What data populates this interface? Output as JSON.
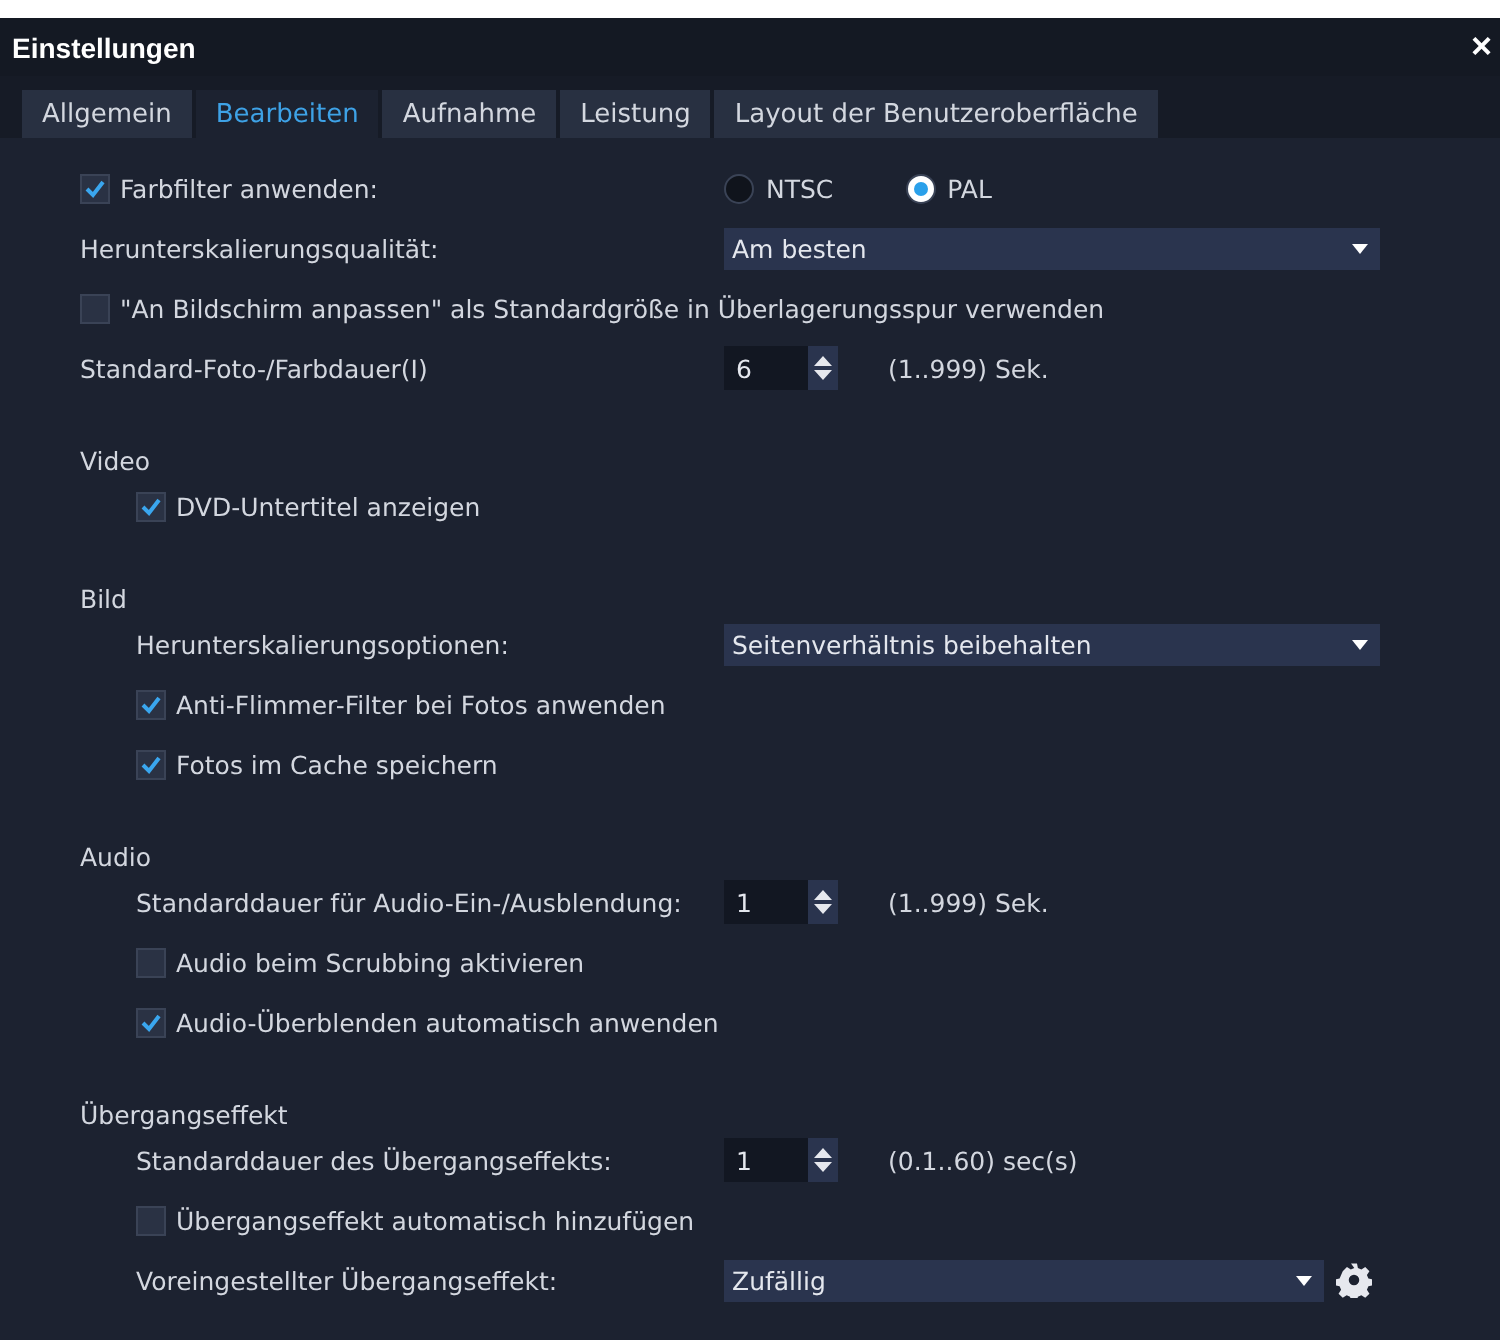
{
  "window": {
    "title": "Einstellungen",
    "close": "×"
  },
  "tabs": [
    {
      "label": "Allgemein",
      "selected": false
    },
    {
      "label": "Bearbeiten",
      "selected": true
    },
    {
      "label": "Aufnahme",
      "selected": false
    },
    {
      "label": "Leistung",
      "selected": false
    },
    {
      "label": "Layout der Benutzeroberfläche",
      "selected": false
    }
  ],
  "rows": [
    {
      "kind": "checkbox",
      "label": "Farbfilter anwenden:",
      "checked": true,
      "options": [
        {
          "label": "NTSC",
          "selected": false
        },
        {
          "label": "PAL",
          "selected": true
        }
      ]
    },
    {
      "kind": "dropdown",
      "label": "Herunterskalierungsqualität:",
      "value": "Am besten"
    },
    {
      "kind": "checkbox",
      "label": "\"An Bildschirm anpassen\" als Standardgröße in Überlagerungsspur verwenden",
      "checked": false
    },
    {
      "kind": "spinner",
      "label": "Standard-Foto-/Farbdauer(I)",
      "value": "6",
      "range": "(1..999) Sek."
    }
  ],
  "sections": [
    {
      "title": "Video",
      "children": [
        {
          "kind": "checkbox",
          "label": "DVD-Untertitel anzeigen",
          "checked": true
        }
      ]
    },
    {
      "title": "Bild",
      "children": [
        {
          "kind": "dropdown",
          "label": "Herunterskalierungsoptionen:",
          "value": "Seitenverhältnis beibehalten"
        },
        {
          "kind": "checkbox",
          "label": "Anti-Flimmer-Filter bei Fotos anwenden",
          "checked": true
        },
        {
          "kind": "checkbox",
          "label": "Fotos im Cache speichern",
          "checked": true
        }
      ]
    },
    {
      "title": "Audio",
      "children": [
        {
          "kind": "spinner",
          "label": "Standarddauer für Audio-Ein-/Ausblendung:",
          "value": "1",
          "range": "(1..999) Sek."
        },
        {
          "kind": "checkbox",
          "label": "Audio beim Scrubbing aktivieren",
          "checked": false
        },
        {
          "kind": "checkbox",
          "label": "Audio-Überblenden automatisch anwenden",
          "checked": true
        }
      ]
    },
    {
      "title": "Übergangseffekt",
      "children": [
        {
          "kind": "spinner",
          "label": "Standarddauer des Übergangseffekts:",
          "value": "1",
          "range": "(0.1..60) sec(s)"
        },
        {
          "kind": "checkbox",
          "label": "Übergangseffekt automatisch hinzufügen",
          "checked": false
        },
        {
          "kind": "dropdown",
          "label": "Voreingestellter Übergangseffekt:",
          "value": "Zufällig",
          "settings_button": true
        }
      ]
    }
  ]
}
